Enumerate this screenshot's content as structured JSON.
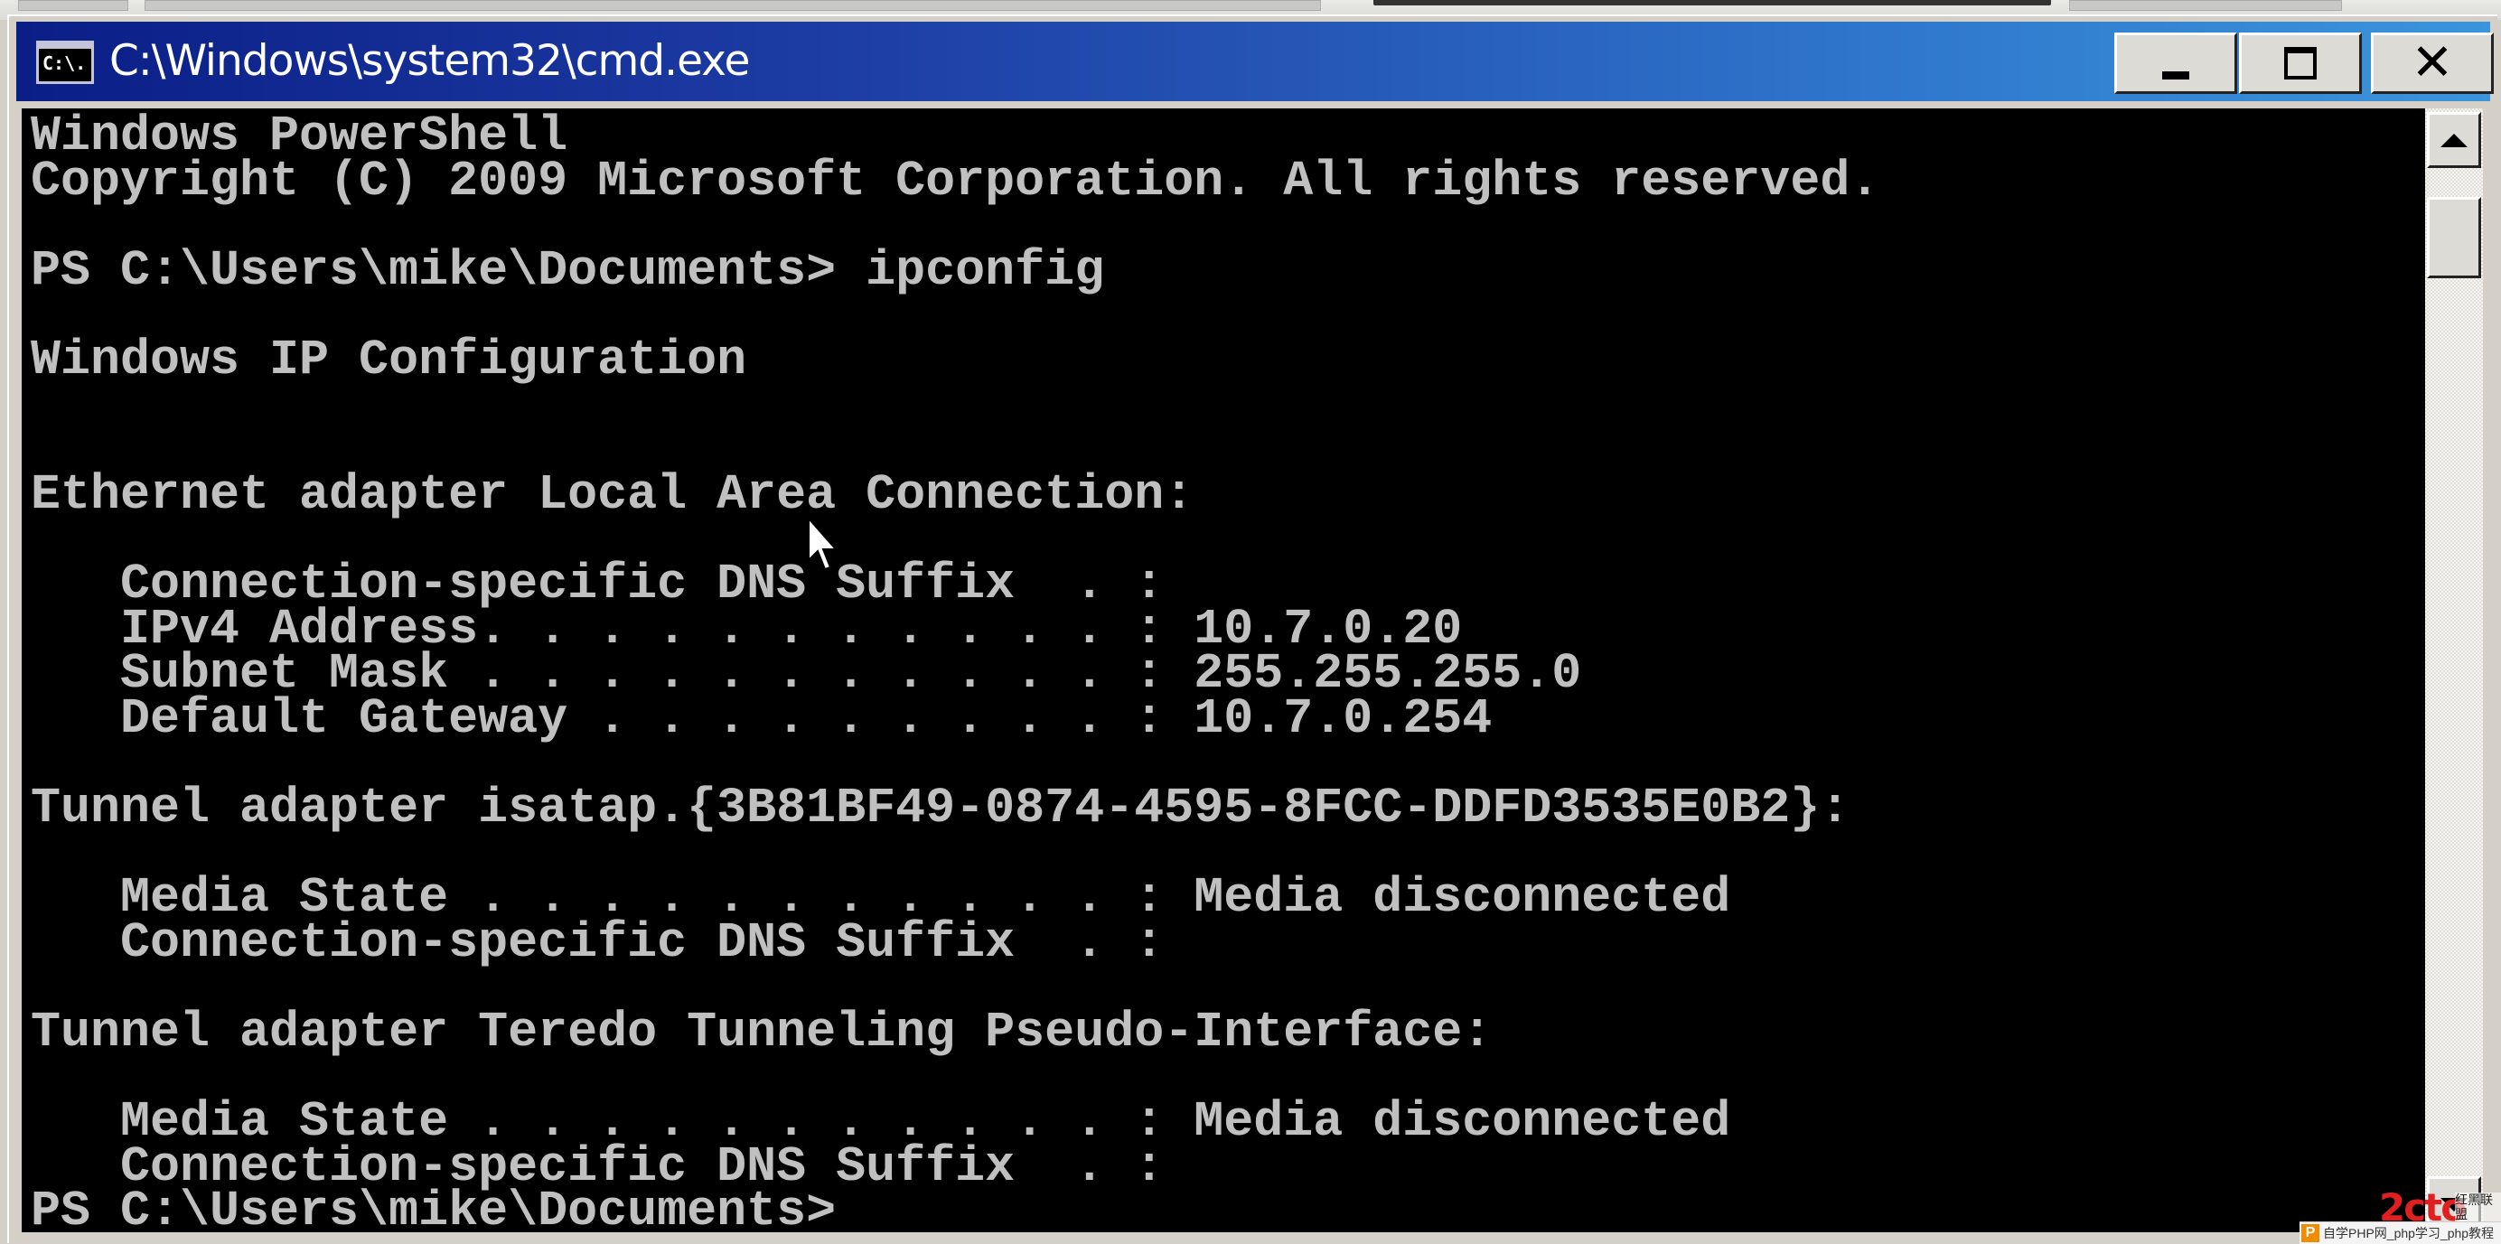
{
  "window": {
    "title": "C:\\Windows\\system32\\cmd.exe",
    "icon_label": "C:\\.",
    "controls": {
      "minimize": "minimize-icon",
      "maximize": "maximize-icon",
      "close": "close-icon",
      "close_glyph": "✕"
    }
  },
  "console": {
    "text": "Windows PowerShell\nCopyright (C) 2009 Microsoft Corporation. All rights reserved.\n\nPS C:\\Users\\mike\\Documents> ipconfig\n\nWindows IP Configuration\n\n\nEthernet adapter Local Area Connection:\n\n   Connection-specific DNS Suffix  . :\n   IPv4 Address. . . . . . . . . . . : 10.7.0.20\n   Subnet Mask . . . . . . . . . . . : 255.255.255.0\n   Default Gateway . . . . . . . . . : 10.7.0.254\n\nTunnel adapter isatap.{3B81BF49-0874-4595-8FCC-DDFD3535E0B2}:\n\n   Media State . . . . . . . . . . . : Media disconnected\n   Connection-specific DNS Suffix  . :\n\nTunnel adapter Teredo Tunneling Pseudo-Interface:\n\n   Media State . . . . . . . . . . . : Media disconnected\n   Connection-specific DNS Suffix  . :\nPS C:\\Users\\mike\\Documents>",
    "colors": {
      "background": "#000000",
      "foreground": "#c0c0c0"
    }
  },
  "watermark": {
    "logo": "2cto",
    "tag": "红黑联盟",
    "bar_icon": "P",
    "bar_text": "自学PHP网_php学习_php教程"
  },
  "theme": {
    "titlebar_start": "#0a1e86",
    "titlebar_end": "#3b95db"
  }
}
